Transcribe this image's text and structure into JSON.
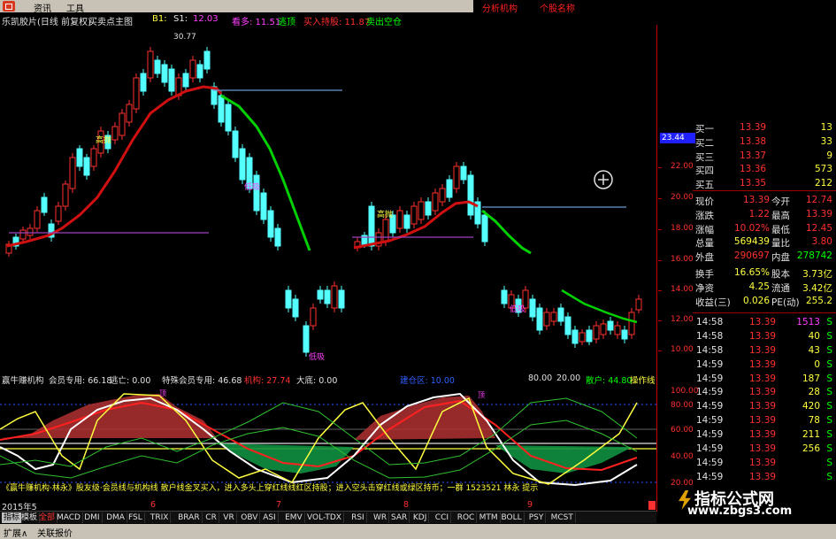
{
  "menu": {
    "items": [
      "资讯",
      "工具"
    ],
    "right_labels": [
      "分析机构",
      "个股名称"
    ]
  },
  "header": {
    "stock_name": "乐凯胶片(日线 前复权)",
    "indicator_name": "买卖点主图",
    "b1_label": "B1:",
    "s1_label": "S1:",
    "s1_value": "12.03",
    "fields": [
      {
        "label": "看多: 11.51",
        "color": "#ff40ff"
      },
      {
        "label": "逃顶",
        "color": "#00ff00"
      },
      {
        "label": "买入持股: 11.87",
        "color": "#ff3030"
      },
      {
        "label": "卖出空仓",
        "color": "#00ff00"
      }
    ]
  },
  "price_axis": {
    "labels": [
      "23.44",
      "22.00",
      "20.00",
      "18.00",
      "16.00",
      "14.00",
      "12.00",
      "10.00"
    ],
    "current": "23.44"
  },
  "chart_annotations": {
    "high": "30.77",
    "labels": [
      "高抛",
      "低吸",
      "高抛",
      "低吸",
      "低吸"
    ]
  },
  "quote": {
    "bids": [
      {
        "label": "买一",
        "price": "13.39",
        "vol": "13"
      },
      {
        "label": "买二",
        "price": "13.38",
        "vol": "33"
      },
      {
        "label": "买三",
        "price": "13.37",
        "vol": "9"
      },
      {
        "label": "买四",
        "price": "13.36",
        "vol": "573"
      },
      {
        "label": "买五",
        "price": "13.35",
        "vol": "212"
      }
    ],
    "stats": [
      {
        "l1": "现价",
        "v1": "13.39",
        "c1": "#ff3030",
        "l2": "今开",
        "v2": "12.74",
        "c2": "#ff3030"
      },
      {
        "l1": "涨跌",
        "v1": "1.22",
        "c1": "#ff3030",
        "l2": "最高",
        "v2": "13.39",
        "c2": "#ff3030"
      },
      {
        "l1": "涨幅",
        "v1": "10.02%",
        "c1": "#ff3030",
        "l2": "最低",
        "v2": "12.45",
        "c2": "#ff3030"
      },
      {
        "l1": "总量",
        "v1": "569439",
        "c1": "#ffff40",
        "l2": "量比",
        "v2": "3.80",
        "c2": "#ff3030"
      },
      {
        "l1": "外盘",
        "v1": "290697",
        "c1": "#ff3030",
        "l2": "内盘",
        "v2": "278742",
        "c2": "#00ff00"
      },
      {
        "l1": "换手",
        "v1": "16.65%",
        "c1": "#ffff40",
        "l2": "股本",
        "v2": "3.73亿",
        "c2": "#ffff40"
      },
      {
        "l1": "净资",
        "v1": "4.25",
        "c1": "#ffff40",
        "l2": "流通",
        "v2": "3.42亿",
        "c2": "#ffff40"
      },
      {
        "l1": "收益(三)",
        "v1": "0.026",
        "c1": "#ffff40",
        "l2": "PE(动)",
        "v2": "255.2",
        "c2": "#ffff40"
      }
    ]
  },
  "ticks": [
    {
      "time": "14:58",
      "price": "13.39",
      "vol": "1513",
      "side": "S"
    },
    {
      "time": "14:58",
      "price": "13.39",
      "vol": "40",
      "side": "S"
    },
    {
      "time": "14:58",
      "price": "13.39",
      "vol": "43",
      "side": "S"
    },
    {
      "time": "14:59",
      "price": "13.39",
      "vol": "0",
      "side": "S"
    },
    {
      "time": "14:59",
      "price": "13.39",
      "vol": "187",
      "side": "S"
    },
    {
      "time": "14:59",
      "price": "13.39",
      "vol": "28",
      "side": "S"
    },
    {
      "time": "14:59",
      "price": "13.39",
      "vol": "420",
      "side": "S"
    },
    {
      "time": "14:59",
      "price": "13.39",
      "vol": "78",
      "side": "S"
    },
    {
      "time": "14:59",
      "price": "13.39",
      "vol": "211",
      "side": "S"
    },
    {
      "time": "14:59",
      "price": "13.39",
      "vol": "256",
      "side": "S"
    },
    {
      "time": "14:59",
      "price": "13.39",
      "vol": "",
      "side": "S"
    },
    {
      "time": "14:59",
      "price": "13.39",
      "vol": "",
      "side": "S"
    }
  ],
  "indicator": {
    "name": "赢牛赚机构",
    "fields": [
      {
        "label": "会员专用: 66.18",
        "color": "#e0e0e0"
      },
      {
        "label": "逃亡: 0.00",
        "color": "#e0e0e0"
      },
      {
        "label": "特殊会员专用: 46.68",
        "color": "#e0e0e0"
      },
      {
        "label": "机构: 27.74",
        "color": "#ff3030"
      },
      {
        "label": "大底: 0.00",
        "color": "#e0e0e0"
      },
      {
        "label": "建仓区: 10.00",
        "color": "#3060ff"
      },
      {
        "label": "80.00",
        "color": "#e0e0e0"
      },
      {
        "label": "20.00",
        "color": "#e0e0e0"
      },
      {
        "label": "散户: 44.80",
        "color": "#00ff00"
      },
      {
        "label": "操作线",
        "color": "#ffff40"
      }
    ],
    "axis": [
      "100.00",
      "80.00",
      "60.00",
      "40.00",
      "20.00"
    ],
    "scroll_text": "《赢牛赚机构·林永》股友级·会员线与机构线 散户线金叉买入，进入多头上穿红线线红区持股；进入空头击穿红线或绿区持币；一群 1523521 林永 提示",
    "tops": [
      "顶",
      "顶"
    ]
  },
  "dates": {
    "start": "2015年5",
    "marks": [
      "6",
      "7",
      "8",
      "9"
    ]
  },
  "tabs": [
    "指标",
    "模板",
    "全部",
    "MACD",
    "DMI",
    "DMA",
    "FSL",
    "TRIX",
    "BRAR",
    "CR",
    "VR",
    "OBV",
    "ASI",
    "EMV",
    "VOL-TDX",
    "RSI",
    "WR",
    "SAR",
    "KDJ",
    "CCI",
    "ROC",
    "MTM",
    "BOLL",
    "PSY",
    "MCST"
  ],
  "bottombar": {
    "items": [
      "扩展∧",
      "关联报价"
    ]
  },
  "watermark": {
    "title": "指标公式网",
    "url": "www.zbgs3.com"
  },
  "colors": {
    "up": "#ff3030",
    "down": "#54ffff",
    "ma": "#d01010",
    "green": "#00e000",
    "yellow": "#ffff40",
    "purple": "#ff40ff"
  }
}
